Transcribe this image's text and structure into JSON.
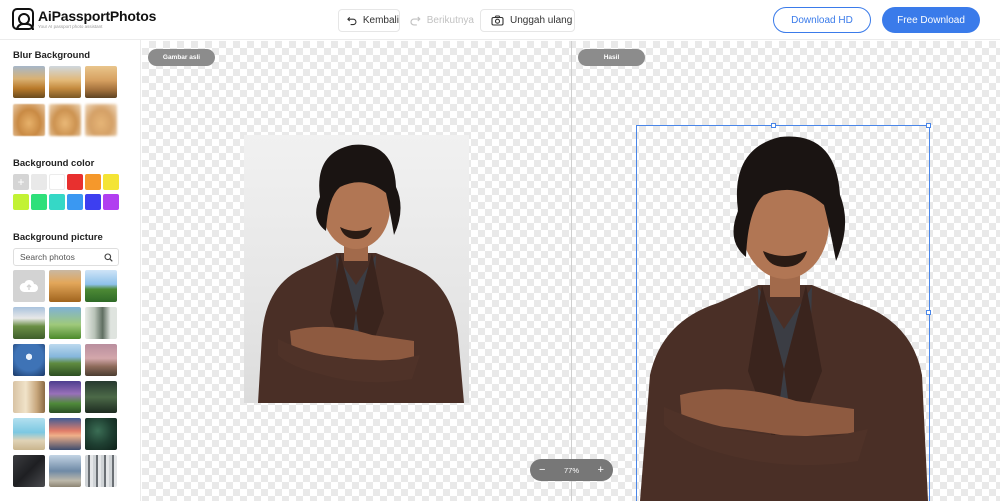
{
  "app": {
    "logo_title": "AiPassportPhotos",
    "logo_subtitle": "Your AI passport photo assistant"
  },
  "toolbar": {
    "back_label": "Kembali",
    "next_label": "Berikutnya",
    "reupload_label": "Unggah ulang",
    "download_hd_label": "Download HD",
    "free_download_label": "Free Download"
  },
  "sidebar": {
    "blur_title": "Blur Background",
    "color_title": "Background color",
    "colors": [
      "#d5d5d5",
      "#e9e9e9",
      "#ffffff",
      "#e8302f",
      "#f5982b",
      "#f4e435",
      "#c2f234",
      "#2ee07a",
      "#35d8c6",
      "#3a98f2",
      "#3d3ff0",
      "#b13ff0"
    ],
    "picture_title": "Background picture",
    "search_placeholder": "Search photos"
  },
  "canvas": {
    "original_label": "Gambar asli",
    "result_label": "Hasil",
    "zoom_level": "77%",
    "zoom_out": "−",
    "zoom_in": "+"
  }
}
